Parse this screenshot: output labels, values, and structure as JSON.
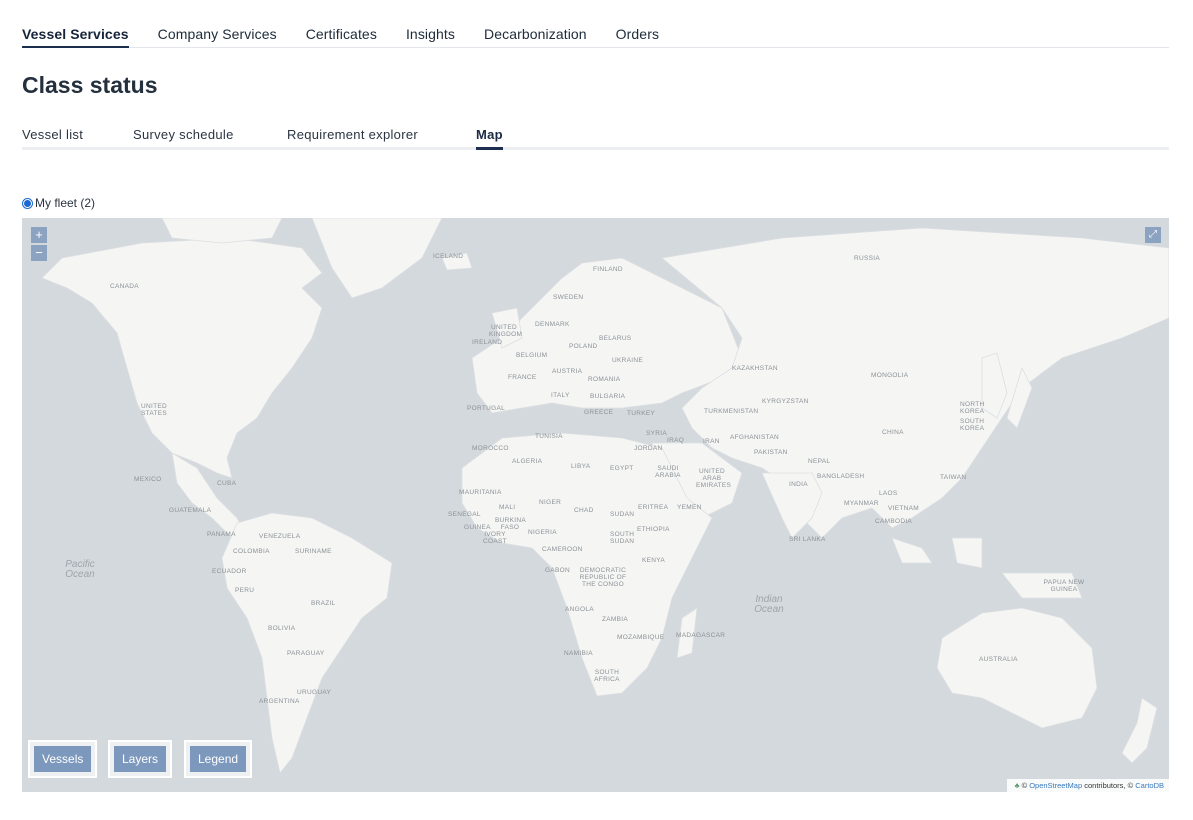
{
  "topnav": {
    "items": [
      "Vessel Services",
      "Company Services",
      "Certificates",
      "Insights",
      "Decarbonization",
      "Orders"
    ],
    "active": "Vessel Services"
  },
  "page": {
    "title": "Class status"
  },
  "subtabs": {
    "items": [
      "Vessel list",
      "Survey schedule",
      "Requirement explorer",
      "Map"
    ],
    "active": "Map"
  },
  "fleet": {
    "label": "My fleet (2)",
    "selected": true
  },
  "map": {
    "zoom_in": "+",
    "zoom_out": "−",
    "fullscreen_icon": "expand-icon",
    "buttons": {
      "vessels": "Vessels",
      "layers": "Layers",
      "legend": "Legend"
    },
    "attribution": {
      "prefix": "©",
      "osm": "OpenStreetMap",
      "contributors": "contributors, ©",
      "carto": "CartoDB"
    },
    "countries": [
      "CANADA",
      "ICELAND",
      "RUSSIA",
      "FINLAND",
      "SWEDEN",
      "DENMARK",
      "UNITED KINGDOM",
      "IRELAND",
      "BELARUS",
      "POLAND",
      "BELGIUM",
      "UKRAINE",
      "FRANCE",
      "AUSTRIA",
      "ROMANIA",
      "KAZAKHSTAN",
      "MONGOLIA",
      "UNITED STATES",
      "PORTUGAL",
      "ITALY",
      "BULGARIA",
      "GREECE",
      "TURKEY",
      "TURKMENISTAN",
      "KYRGYZSTAN",
      "NORTH KOREA",
      "SOUTH KOREA",
      "TUNISIA",
      "SYRIA",
      "IRAQ",
      "IRAN",
      "AFGHANISTAN",
      "CHINA",
      "MOROCCO",
      "JORDAN",
      "PAKISTAN",
      "ALGERIA",
      "LIBYA",
      "EGYPT",
      "SAUDI ARABIA",
      "NEPAL",
      "MEXICO",
      "UNITED ARAB EMIRATES",
      "INDIA",
      "BANGLADESH",
      "TAIWAN",
      "CUBA",
      "MAURITANIA",
      "NIGER",
      "MALI",
      "LAOS",
      "GUATEMALA",
      "CHAD",
      "SUDAN",
      "ERITREA",
      "YEMEN",
      "MYANMAR",
      "VIETNAM",
      "SENEGAL",
      "BURKINA FASO",
      "ETHIOPIA",
      "CAMBODIA",
      "PANAMA",
      "VENEZUELA",
      "GUINEA",
      "NIGERIA",
      "IVORY COAST",
      "SOUTH SUDAN",
      "SRI LANKA",
      "COLOMBIA",
      "SURINAME",
      "CAMEROON",
      "KENYA",
      "ECUADOR",
      "GABON",
      "DEMOCRATIC REPUBLIC OF THE CONGO",
      "PAPUA NEW GUINEA",
      "PERU",
      "BRAZIL",
      "ANGOLA",
      "ZAMBIA",
      "BOLIVIA",
      "MOZAMBIQUE",
      "MADAGASCAR",
      "PARAGUAY",
      "NAMIBIA",
      "AUSTRALIA",
      "SOUTH AFRICA",
      "URUGUAY",
      "ARGENTINA"
    ],
    "oceans": [
      "Pacific Ocean",
      "Indian Ocean"
    ]
  }
}
